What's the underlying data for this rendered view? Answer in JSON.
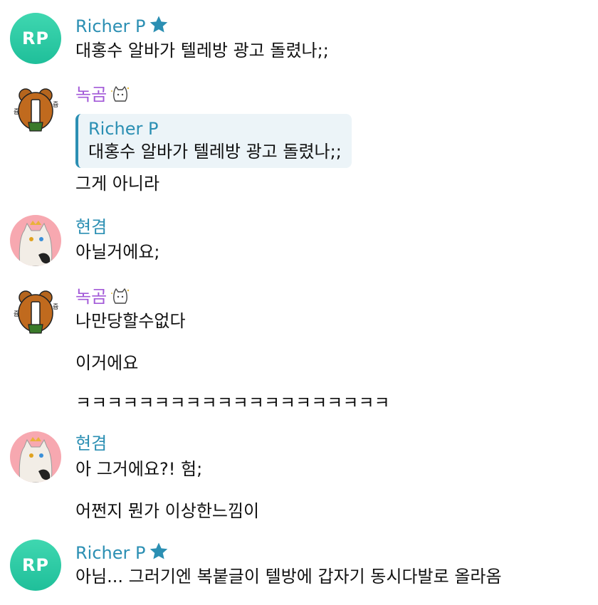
{
  "messages": [
    {
      "author": "Richer P",
      "text": "대홍수 알바가 텔레방 광고 돌렸나;;"
    },
    {
      "author": "녹곰",
      "reply_to": {
        "author": "Richer P",
        "text": "대홍수 알바가 텔레방 광고 돌렸나;;"
      },
      "text": "그게 아니라"
    },
    {
      "author": "현겸",
      "text": "아닐거에요;"
    },
    {
      "author": "녹곰",
      "lines": [
        "나만당할수없다",
        "이거에요",
        "ㅋㅋㅋㅋㅋㅋㅋㅋㅋㅋㅋㅋㅋㅋㅋㅋㅋㅋㅋㅋ"
      ]
    },
    {
      "author": "현겸",
      "lines": [
        "아 그거에요?! 험;",
        "어쩐지 뭔가 이상한느낌이"
      ]
    },
    {
      "author": "Richer P",
      "text": "아님... 그러기엔 복붙글이 텔방에 갑자기 동시다발로 올라옴"
    }
  ],
  "avatars": {
    "richer_initials": "RP"
  },
  "icons": {
    "rp_badge": "star-icon",
    "bear_badge": "cat-sticker-icon"
  },
  "colors": {
    "name_blue": "#2b8fb3",
    "name_purple": "#a35ad8",
    "avatar_green": "#2cc9a3",
    "reply_bg": "#ecf4f8"
  }
}
